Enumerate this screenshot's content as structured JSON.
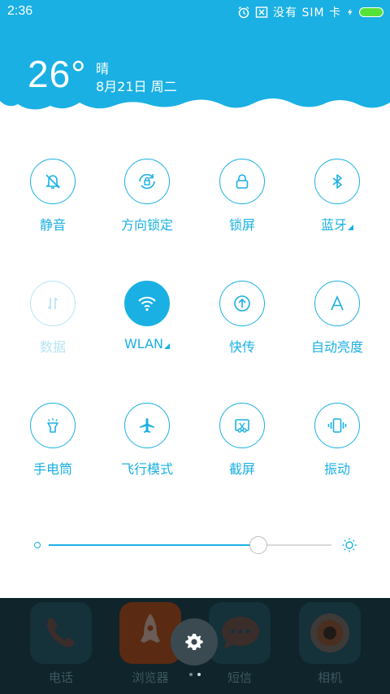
{
  "status_bar": {
    "time": "2:36",
    "sim_text": "没有 SIM 卡",
    "icons": [
      "alarm-icon",
      "no-sim-icon",
      "charging-icon",
      "battery-icon"
    ]
  },
  "weather": {
    "temperature": "26°",
    "condition": "晴",
    "date": "8月21日 周二"
  },
  "toggles": [
    {
      "label": "静音",
      "icon": "silent-bell-icon",
      "state": "off"
    },
    {
      "label": "方向锁定",
      "icon": "rotation-lock-icon",
      "state": "off"
    },
    {
      "label": "锁屏",
      "icon": "lock-icon",
      "state": "off"
    },
    {
      "label": "蓝牙",
      "icon": "bluetooth-icon",
      "state": "off",
      "has_more": true
    },
    {
      "label": "数据",
      "icon": "mobile-data-icon",
      "state": "disabled"
    },
    {
      "label": "WLAN",
      "icon": "wifi-icon",
      "state": "on",
      "has_more": true
    },
    {
      "label": "快传",
      "icon": "quick-transfer-icon",
      "state": "off"
    },
    {
      "label": "自动亮度",
      "icon": "auto-brightness-icon",
      "state": "off"
    },
    {
      "label": "手电筒",
      "icon": "flashlight-icon",
      "state": "off"
    },
    {
      "label": "飞行模式",
      "icon": "airplane-icon",
      "state": "off"
    },
    {
      "label": "截屏",
      "icon": "screenshot-icon",
      "state": "off"
    },
    {
      "label": "振动",
      "icon": "vibrate-icon",
      "state": "off"
    }
  ],
  "brightness": {
    "level": 0.74
  },
  "dock": {
    "apps": [
      {
        "label": "电话",
        "icon": "phone-icon"
      },
      {
        "label": "浏览器",
        "icon": "browser-rocket-icon"
      },
      {
        "label": "短信",
        "icon": "messages-icon"
      },
      {
        "label": "相机",
        "icon": "camera-icon"
      }
    ],
    "page_indicator": {
      "pages": 2,
      "current": 2
    }
  },
  "colors": {
    "accent": "#1ab0e3",
    "header": "#1ab0e3",
    "dock": "#0f242b"
  }
}
